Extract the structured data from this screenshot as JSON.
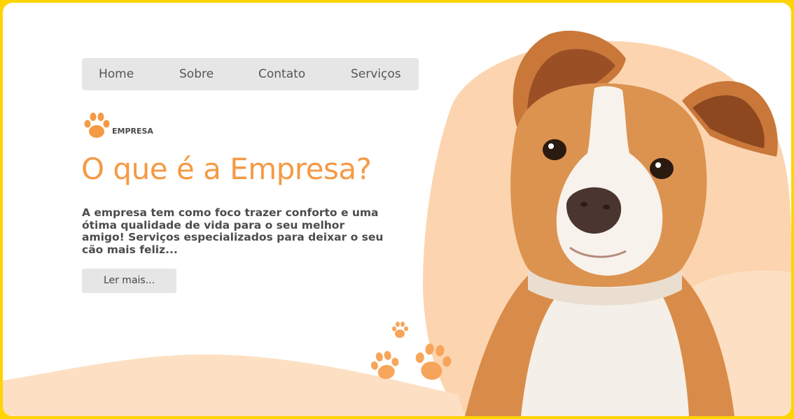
{
  "nav": {
    "items": [
      {
        "label": "Home"
      },
      {
        "label": "Sobre"
      },
      {
        "label": "Contato"
      },
      {
        "label": "Serviços"
      }
    ]
  },
  "brand": {
    "label": "EMPRESA",
    "icon": "paw-icon"
  },
  "hero": {
    "title": "O que é a Empresa?",
    "description": "A empresa tem como foco trazer conforto e uma ótima qualidade de vida para o seu melhor amigo! Serviços especializados para deixar o seu cão mais feliz...",
    "button_label": "Ler mais..."
  },
  "colors": {
    "accent": "#f49a45",
    "blob": "#fcd5b0",
    "frame": "#ffd400",
    "nav_bg": "#e6e6e6"
  }
}
